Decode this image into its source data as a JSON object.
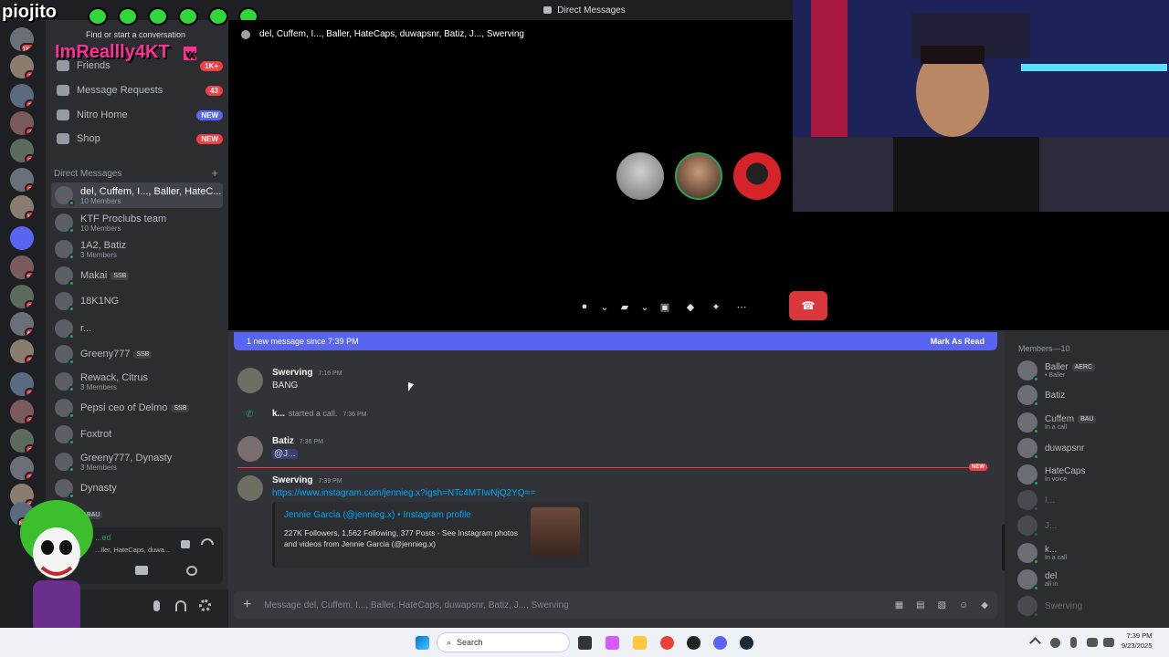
{
  "titlebar": {
    "title": "Direct Messages"
  },
  "stream_overlay": {
    "streamer_name": "piojito",
    "subscriber_name": "ImReallly4KT",
    "sub_suffix": "w"
  },
  "sidebar": {
    "find_conversation": "Find or start a conversation",
    "nav": [
      {
        "label": "Friends",
        "badge": "1K+"
      },
      {
        "label": "Message Requests",
        "badge": "43"
      },
      {
        "label": "Nitro Home",
        "badge": "NEW"
      },
      {
        "label": "Shop",
        "badge": "NEW"
      }
    ],
    "dm_header": "Direct Messages",
    "dm_add": "+",
    "dms": [
      {
        "name": "del, Cuffem, I..., Baller, HateC...",
        "sub": "10 Members",
        "tag": ""
      },
      {
        "name": "KTF Proclubs team",
        "sub": "10 Members",
        "tag": ""
      },
      {
        "name": "1A2, Batiz",
        "sub": "3 Members",
        "tag": ""
      },
      {
        "name": "Makai",
        "sub": "",
        "tag": "SSB"
      },
      {
        "name": "18K1NG",
        "sub": "",
        "tag": ""
      },
      {
        "name": "r...",
        "sub": "",
        "tag": ""
      },
      {
        "name": "Greeny777",
        "sub": "",
        "tag": "SSB"
      },
      {
        "name": "Rewack, Citrus",
        "sub": "3 Members",
        "tag": ""
      },
      {
        "name": "Pepsi ceo of Delmo",
        "sub": "",
        "tag": "SSB"
      },
      {
        "name": "Foxtrot",
        "sub": "",
        "tag": ""
      },
      {
        "name": "Greeny777, Dynasty",
        "sub": "3 Members",
        "tag": ""
      },
      {
        "name": "Dynasty",
        "sub": "",
        "tag": ""
      },
      {
        "name": "",
        "sub": "",
        "tag": "BAU"
      }
    ],
    "voice": {
      "status": "...ed",
      "channel": "...Iler, HateCaps, duwa..."
    }
  },
  "servers": [
    {
      "badge": "1K+"
    },
    {
      "badge": "1"
    },
    {
      "badge": "2"
    },
    {
      "badge": "4"
    },
    {
      "badge": "3"
    },
    {
      "badge": "2"
    },
    {
      "badge": "11"
    },
    {
      "badge": ""
    },
    {
      "badge": "39"
    },
    {
      "badge": "7"
    },
    {
      "badge": "46"
    },
    {
      "badge": "1"
    },
    {
      "badge": "1"
    },
    {
      "badge": "1"
    },
    {
      "badge": "3"
    },
    {
      "badge": "1"
    },
    {
      "badge": "1"
    },
    {
      "badge": "NEW"
    }
  ],
  "call": {
    "title": "del, Cuffem, I..., Baller, HateCaps, duwapsnr, Batiz, J..., Swerving"
  },
  "chat": {
    "banner_text": "1 new message since 7:39 PM",
    "banner_action": "Mark As Read",
    "messages": [
      {
        "author": "Swerving",
        "time": "7:16 PM",
        "text": "BANG"
      },
      {
        "author": "k...",
        "time": "7:36 PM",
        "text": "started a call."
      },
      {
        "author": "Batiz",
        "time": "7:36 PM",
        "text": "@J..."
      },
      {
        "author": "Swerving",
        "time": "7:39 PM",
        "text": "https://www.instagram.com/jennieg.x?igsh=NTc4MTIwNjQ2YQ=="
      }
    ],
    "new_label": "NEW",
    "embed": {
      "title": "Jennie Garcia (@jennieg.x) • Instagram profile",
      "description": "227K Followers, 1,562 Following, 377 Posts - See Instagram photos and videos from Jennie Garcia (@jennieg.x)"
    },
    "composer_placeholder": "Message del, Cuffem, I..., Baller, HateCaps, duwapsnr, Batiz, J..., Swerving"
  },
  "members": {
    "header": "Members—10",
    "list": [
      {
        "name": "Baller",
        "status": "• Baller",
        "tag": "AERC"
      },
      {
        "name": "Batiz",
        "status": "",
        "tag": ""
      },
      {
        "name": "Cuffem",
        "status": "In a call",
        "tag": "BAU"
      },
      {
        "name": "duwapsnr",
        "status": "",
        "tag": ""
      },
      {
        "name": "HateCaps",
        "status": "In voice",
        "tag": ""
      },
      {
        "name": "I...",
        "status": "",
        "tag": ""
      },
      {
        "name": "J...",
        "status": "",
        "tag": ""
      },
      {
        "name": "k...",
        "status": "In a call",
        "tag": ""
      },
      {
        "name": "del",
        "status": "all in",
        "tag": ""
      },
      {
        "name": "Swerving",
        "status": "",
        "tag": ""
      }
    ]
  },
  "taskbar": {
    "search_label": "Search",
    "time": "7:39 PM",
    "date": "9/23/2025"
  },
  "colors": {
    "blurple": "#5865f2",
    "danger": "#da373c",
    "online": "#23a55a",
    "link": "#00a8fc"
  }
}
